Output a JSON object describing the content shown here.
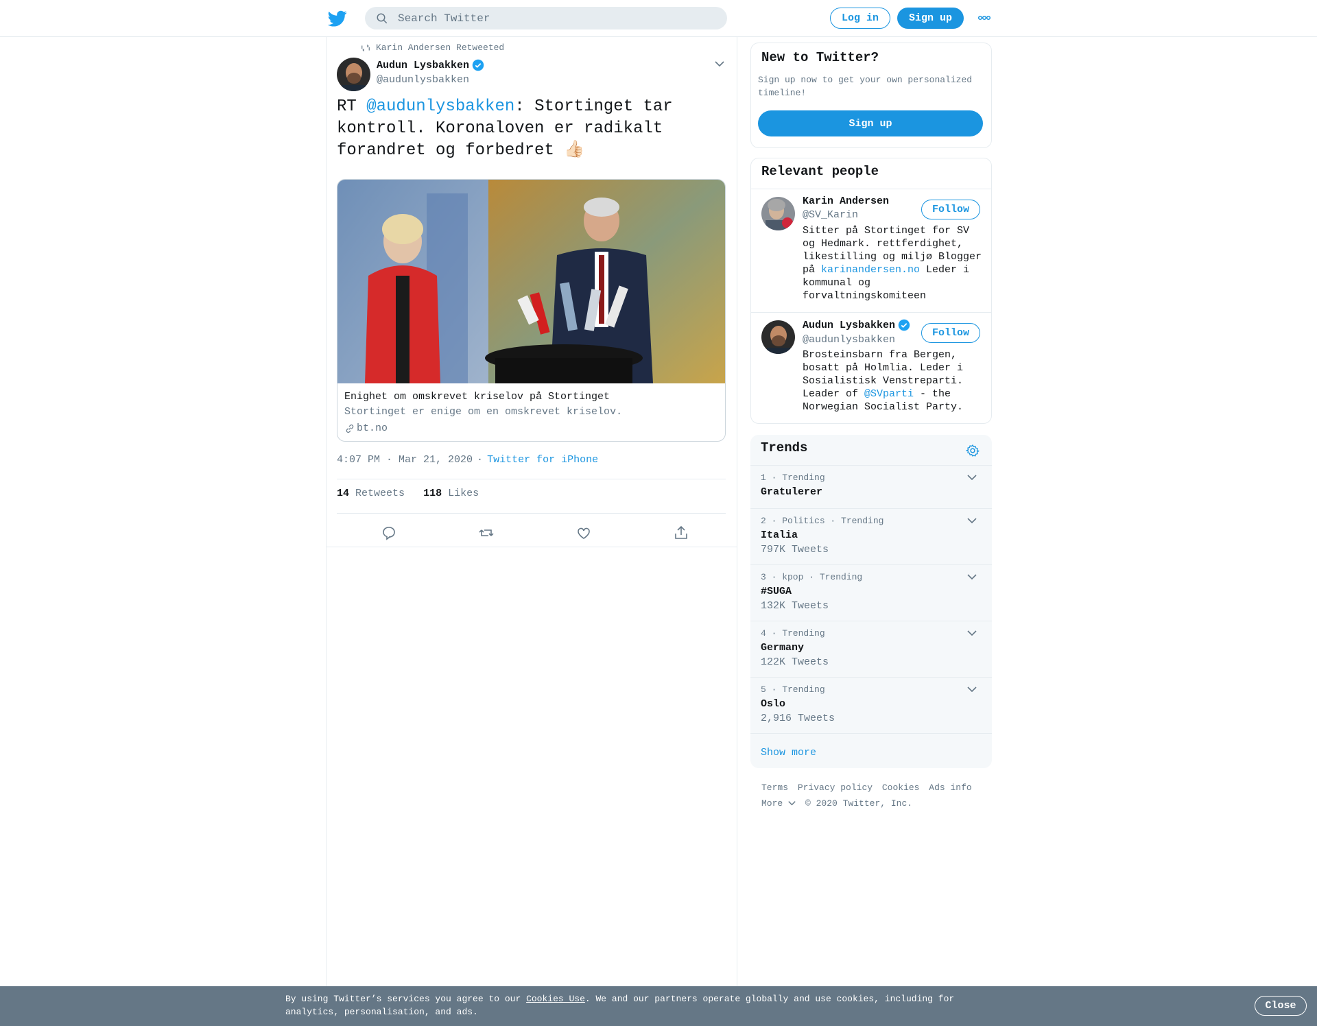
{
  "header": {
    "search_placeholder": "Search Twitter",
    "login_label": "Log in",
    "signup_label": "Sign up"
  },
  "tweet": {
    "retweeted_by": "Karin Andersen Retweeted",
    "author_name": "Audun Lysbakken",
    "author_handle": "@audunlysbakken",
    "verified": true,
    "text_prefix": "RT ",
    "text_mention": "@audunlysbakken",
    "text_body": ": Stortinget tar kontroll. Koronaloven er radikalt forandret og forbedret 👍🏻",
    "card": {
      "title": "Enighet om omskrevet kriselov på Stortinget",
      "description": "Stortinget er enige om en omskrevet kriselov.",
      "domain": "bt.no"
    },
    "time": "4:07 PM · Mar 21, 2020",
    "dot": "·",
    "source": "Twitter for iPhone",
    "retweets_count": "14",
    "retweets_label": "Retweets",
    "likes_count": "118",
    "likes_label": "Likes"
  },
  "sidebar": {
    "new_title": "New to Twitter?",
    "new_sub": "Sign up now to get your own personalized timeline!",
    "new_signup": "Sign up",
    "people_title": "Relevant people",
    "people": [
      {
        "name": "Karin Andersen",
        "handle": "@SV_Karin",
        "follow": "Follow",
        "bio_1": "Sitter på Stortinget for SV og Hedmark. rettferdighet, likestilling og miljø Blogger på ",
        "bio_link": "karinandersen.no",
        "bio_2": " Leder i kommunal og forvaltningskomiteen"
      },
      {
        "name": "Audun Lysbakken",
        "handle": "@audunlysbakken",
        "follow": "Follow",
        "bio_1": "Brosteinsbarn fra Bergen, bosatt på Holmlia. Leder i Sosialistisk Venstreparti. Leader of ",
        "bio_link": "@SVparti",
        "bio_2": " - the Norwegian Socialist Party."
      }
    ],
    "trends_title": "Trends",
    "trends": [
      {
        "meta": "1 · Trending",
        "name": "Gratulerer",
        "count": ""
      },
      {
        "meta": "2 · Politics · Trending",
        "name": "Italia",
        "count": "797K Tweets"
      },
      {
        "meta": "3 · kpop · Trending",
        "name": "#SUGA",
        "count": "132K Tweets"
      },
      {
        "meta": "4 · Trending",
        "name": "Germany",
        "count": "122K Tweets"
      },
      {
        "meta": "5 · Trending",
        "name": "Oslo",
        "count": "2,916 Tweets"
      }
    ],
    "show_more": "Show more"
  },
  "footer": {
    "terms": "Terms",
    "privacy": "Privacy policy",
    "cookies": "Cookies",
    "ads": "Ads info",
    "more": "More",
    "copyright": "© 2020 Twitter, Inc."
  },
  "cookie_bar": {
    "text_1": "By using Twitter’s services you agree to our ",
    "link": "Cookies Use",
    "text_2": ". We and our partners operate globally and use cookies, including for analytics, personalisation, and ads.",
    "close": "Close"
  },
  "colors": {
    "brand_blue": "#1b95e0",
    "muted": "#657786",
    "border": "#e6ecf0",
    "cookie_bg": "#657786"
  }
}
